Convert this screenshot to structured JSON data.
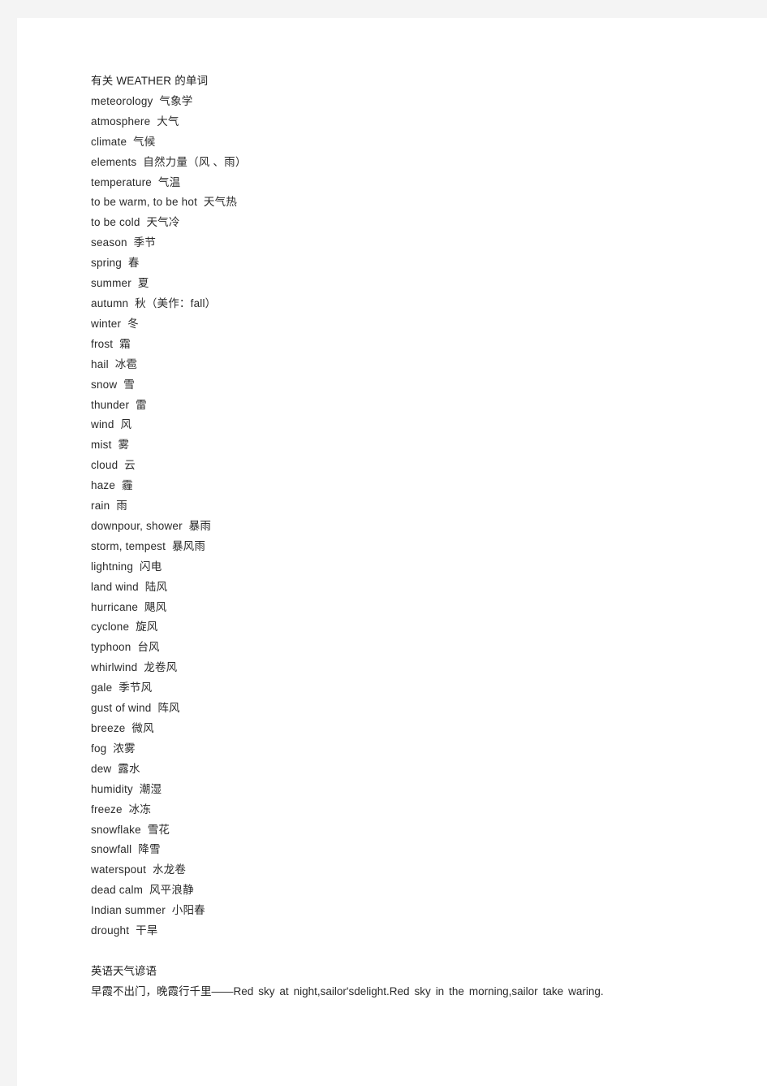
{
  "document": {
    "title_line": "有关 WEATHER 的单词",
    "vocabulary": [
      "meteorology  气象学",
      "atmosphere  大气",
      "climate  气候",
      "elements  自然力量（风 、雨）",
      "temperature  气温",
      "to be warm, to be hot  天气热",
      "to be cold  天气冷",
      "season  季节",
      "spring  春",
      "summer  夏",
      "autumn  秋（美作：fall）",
      "winter  冬",
      "frost  霜",
      "hail  冰雹",
      "snow  雪",
      "thunder  雷",
      "wind  风",
      "mist  雾",
      "cloud  云",
      "haze  霾",
      "rain  雨",
      "downpour, shower  暴雨",
      "storm, tempest  暴风雨",
      "lightning  闪电",
      "land wind  陆风",
      "hurricane  飓风",
      "cyclone  旋风",
      "typhoon  台风",
      "whirlwind  龙卷风",
      "gale  季节风",
      "gust of wind  阵风",
      "breeze  微风",
      "fog  浓雾",
      "dew  露水",
      "humidity  潮湿",
      "freeze  冰冻",
      "snowflake  雪花",
      "snowfall  降雪",
      "waterspout  水龙卷",
      "dead calm  风平浪静",
      "Indian summer  小阳春",
      "drought  干旱"
    ],
    "proverbs_heading": "英语天气谚语",
    "proverbs": [
      "早霞不出门，晚霞行千里——Red sky at night,sailor'sdelight.Red sky in the morning,sailor take waring."
    ]
  }
}
